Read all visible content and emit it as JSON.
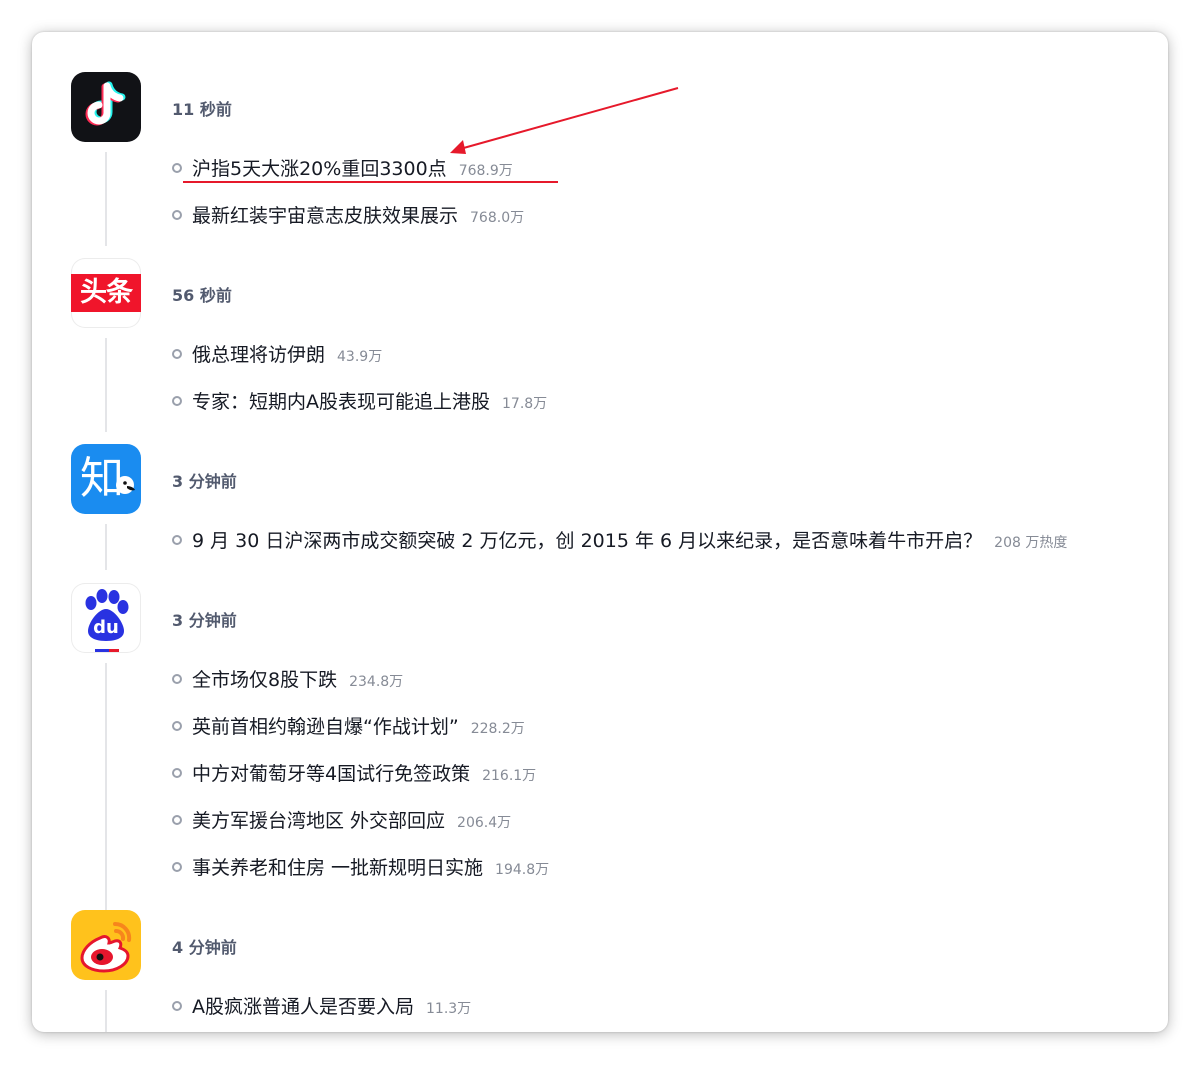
{
  "colors": {
    "annotation": "#e6192b",
    "time_text": "#525a6e",
    "title_text": "#161a24",
    "heat_text": "#868b96",
    "timeline": "#e4e5e8"
  },
  "feeds": [
    {
      "source_icon": "douyin-logo",
      "time": "11 秒前",
      "items": [
        {
          "title": "沪指5天大涨20%重回3300点",
          "heat": "768.9万"
        },
        {
          "title": "最新红装宇宙意志皮肤效果展示",
          "heat": "768.0万"
        }
      ]
    },
    {
      "source_icon": "toutiao-logo",
      "logo_text": "头条",
      "time": "56 秒前",
      "items": [
        {
          "title": "俄总理将访伊朗",
          "heat": "43.9万"
        },
        {
          "title": "专家：短期内A股表现可能追上港股",
          "heat": "17.8万"
        }
      ]
    },
    {
      "source_icon": "zhihu-logo",
      "logo_text": "知",
      "time": "3 分钟前",
      "items": [
        {
          "title": "9 月 30 日沪深两市成交额突破 2 万亿元，创 2015 年 6 月以来纪录，是否意味着牛市开启？",
          "heat": "208 万热度"
        }
      ]
    },
    {
      "source_icon": "baidu-logo",
      "logo_text": "du",
      "time": "3 分钟前",
      "items": [
        {
          "title": "全市场仅8股下跌",
          "heat": "234.8万"
        },
        {
          "title": "英前首相约翰逊自爆“作战计划”",
          "heat": "228.2万"
        },
        {
          "title": "中方对葡萄牙等4国试行免签政策",
          "heat": "216.1万"
        },
        {
          "title": "美方军援台湾地区 外交部回应",
          "heat": "206.4万"
        },
        {
          "title": "事关养老和住房 一批新规明日实施",
          "heat": "194.8万"
        }
      ]
    },
    {
      "source_icon": "weibo-logo",
      "time": "4 分钟前",
      "items": [
        {
          "title": "A股疯涨普通人是否要入局",
          "heat": "11.3万"
        }
      ]
    }
  ]
}
